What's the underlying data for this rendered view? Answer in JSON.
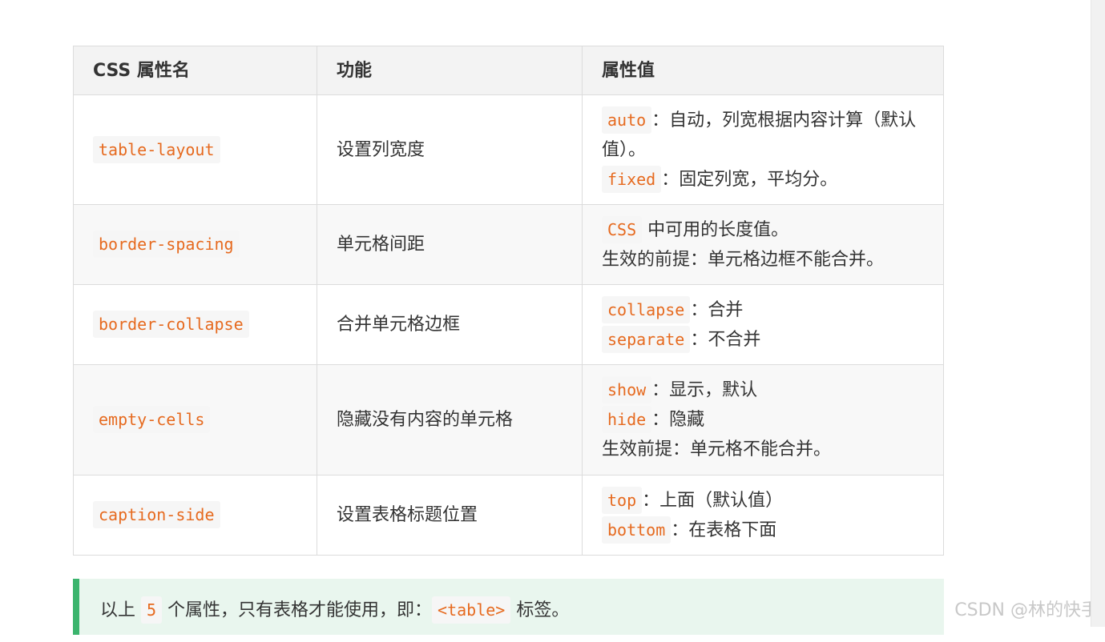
{
  "table": {
    "headers": [
      "CSS 属性名",
      "功能",
      "属性值"
    ],
    "rows": [
      {
        "property": "table-layout",
        "function": "设置列宽度",
        "values": [
          {
            "code": "auto",
            "text": "：自动，列宽根据内容计算（默认值）。"
          },
          {
            "code": "fixed",
            "text": "：固定列宽，平均分。"
          }
        ]
      },
      {
        "property": "border-spacing",
        "function": "单元格间距",
        "values": [
          {
            "code": "CSS",
            "text": " 中可用的长度值。"
          },
          {
            "code": "",
            "text": "生效的前提：单元格边框不能合并。"
          }
        ]
      },
      {
        "property": "border-collapse",
        "function": "合并单元格边框",
        "values": [
          {
            "code": "collapse",
            "text": "：合并"
          },
          {
            "code": "separate",
            "text": "：不合并"
          }
        ]
      },
      {
        "property": "empty-cells",
        "function": "隐藏没有内容的单元格",
        "values": [
          {
            "code": "show",
            "text": "：显示，默认"
          },
          {
            "code": "hide",
            "text": "：隐藏"
          },
          {
            "code": "",
            "text": "生效前提：单元格不能合并。"
          }
        ]
      },
      {
        "property": "caption-side",
        "function": "设置表格标题位置",
        "values": [
          {
            "code": "top",
            "text": "：上面（默认值）"
          },
          {
            "code": "bottom",
            "text": "：在表格下面"
          }
        ]
      }
    ]
  },
  "tip": {
    "prefix": "以上 ",
    "count": "5",
    "middle": " 个属性，只有表格才能使用，即：",
    "tag": "<table>",
    "suffix": " 标签。"
  },
  "watermark": "CSDN @林的快手",
  "colors": {
    "code_text": "#e66a1f",
    "tip_background": "#e9f6ee",
    "tip_border": "#3bb46d",
    "header_background": "#f3f3f3"
  }
}
